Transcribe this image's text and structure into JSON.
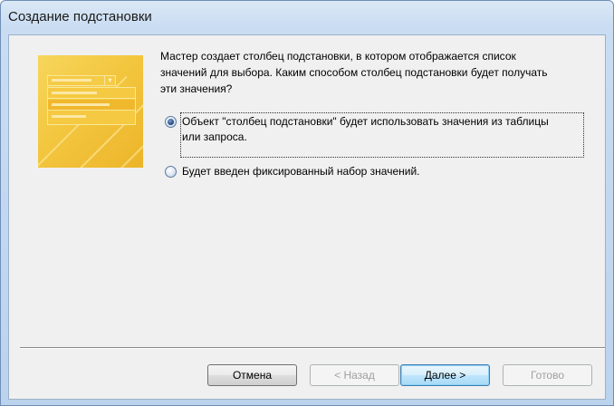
{
  "window": {
    "title": "Создание подстановки"
  },
  "wizard": {
    "description_lines": [
      "Мастер создает столбец подстановки, в котором отображается список",
      "значений для выбора.  Каким способом столбец подстановки будет получать",
      "эти значения?"
    ],
    "options": [
      {
        "label_lines": [
          "Объект \"столбец подстановки\" будет использовать значения из таблицы",
          "или запроса."
        ],
        "selected": true
      },
      {
        "label_lines": [
          "Будет введен фиксированный набор значений."
        ],
        "selected": false
      }
    ]
  },
  "buttons": {
    "cancel": "Отмена",
    "back": "< Назад",
    "next": "Далее >",
    "finish": "Готово"
  },
  "colors": {
    "illustration": "#f2c23a",
    "default_button_border": "#3c7fb1",
    "dialog_background": "#f0f0f0"
  }
}
